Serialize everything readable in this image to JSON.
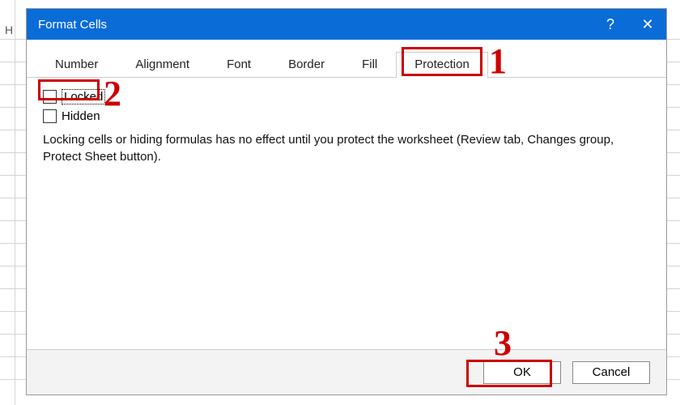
{
  "dialog": {
    "title": "Format Cells",
    "tabs": [
      "Number",
      "Alignment",
      "Font",
      "Border",
      "Fill",
      "Protection"
    ],
    "active_tab_index": 5,
    "protection": {
      "locked_label": "Locked",
      "locked_checked": false,
      "hidden_label": "Hidden",
      "hidden_checked": false,
      "explain": "Locking cells or hiding formulas has no effect until you protect the worksheet (Review tab, Changes group, Protect Sheet button)."
    },
    "footer": {
      "ok_label": "OK",
      "cancel_label": "Cancel"
    }
  },
  "spreadsheet": {
    "column_letter": "H"
  },
  "annotations": {
    "n1": "1",
    "n2": "2",
    "n3": "3"
  },
  "colors": {
    "titlebar": "#0a6cd6",
    "callout": "#c00"
  }
}
